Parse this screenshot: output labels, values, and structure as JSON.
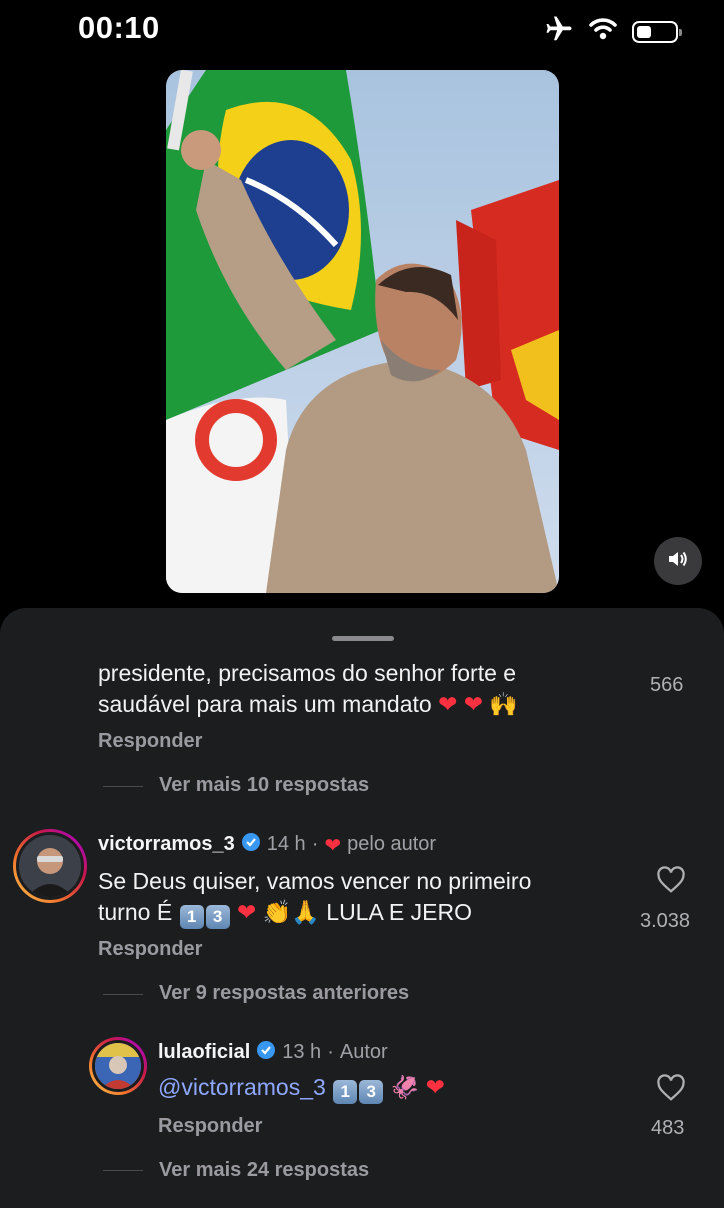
{
  "status_bar": {
    "time": "00:10"
  },
  "comments": {
    "first": {
      "text_line1": "presidente, precisamos do senhor forte e",
      "text_line2": "saudável para mais um mandato",
      "likes": "566",
      "reply_label": "Responder",
      "more_replies": "Ver mais 10 respostas"
    },
    "second": {
      "username": "victorramos_3",
      "time": "14 h",
      "separator": "·",
      "liked_by": "pelo autor",
      "text_line1": "Se Deus quiser, vamos vencer no  primeiro",
      "text_line2_start": "turno É",
      "key1": "1",
      "key2": "3",
      "text_line2_end": "LULA E JERO",
      "likes": "3.038",
      "reply_label": "Responder",
      "previous_replies": "Ver 9 respostas anteriores"
    },
    "reply": {
      "username": "lulaoficial",
      "time": "13 h",
      "separator": "·",
      "role": "Autor",
      "mention": "@victorramos_3",
      "key1": "1",
      "key2": "3",
      "likes": "483",
      "reply_label": "Responder",
      "more_replies": "Ver mais 24 respostas"
    }
  },
  "colors": {
    "background": "#000000",
    "sheet": "#1c1d1f",
    "verified": "#3897f0",
    "heart": "#ff3040",
    "mention": "#8ea8ff"
  }
}
